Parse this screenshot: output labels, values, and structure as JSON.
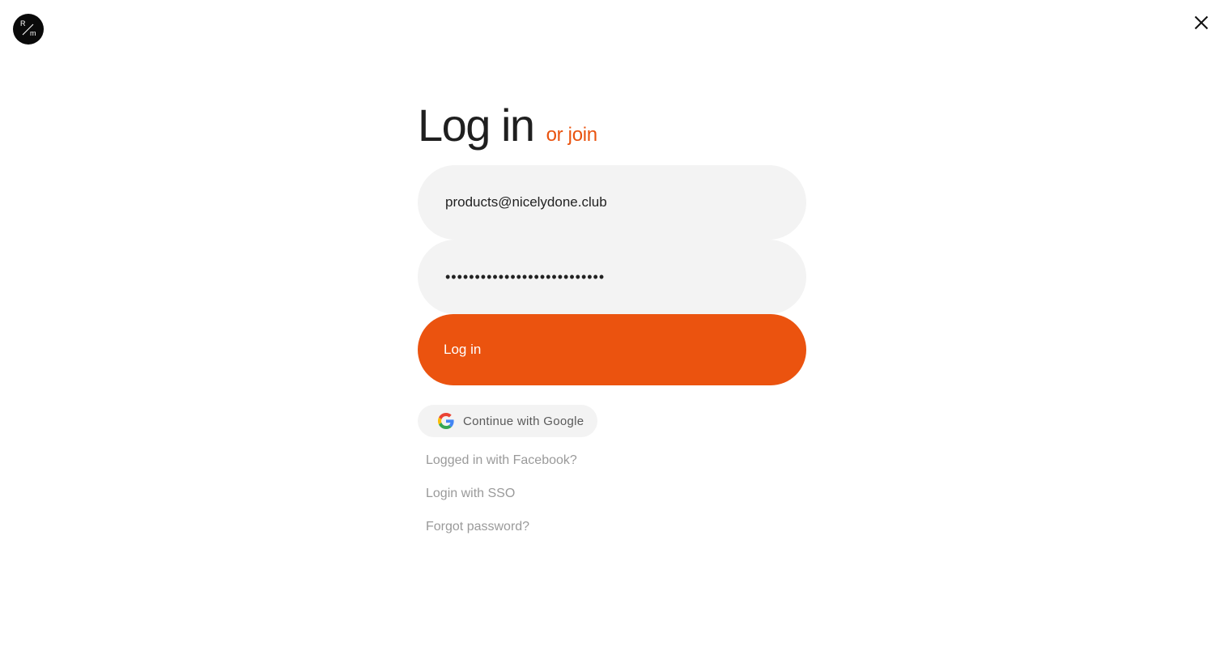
{
  "brand": {
    "logo_letter_top": "R",
    "logo_letter_bottom": "m",
    "logo_icon": "brand-monogram-icon"
  },
  "header": {
    "close_icon": "close-icon"
  },
  "form": {
    "title": "Log in",
    "join_label": "or join",
    "email_value": "products@nicelydone.club",
    "password_value": "•••••••••••••••••••••••••••",
    "login_label": "Log in"
  },
  "social": {
    "google_label": "Continue with Google",
    "google_icon": "google-icon"
  },
  "links": {
    "facebook": "Logged in with Facebook?",
    "sso": "Login with SSO",
    "forgot": "Forgot password?"
  },
  "colors": {
    "accent": "#eb530f",
    "field_bg": "#f3f3f3",
    "muted_text": "#9a9a9a"
  }
}
